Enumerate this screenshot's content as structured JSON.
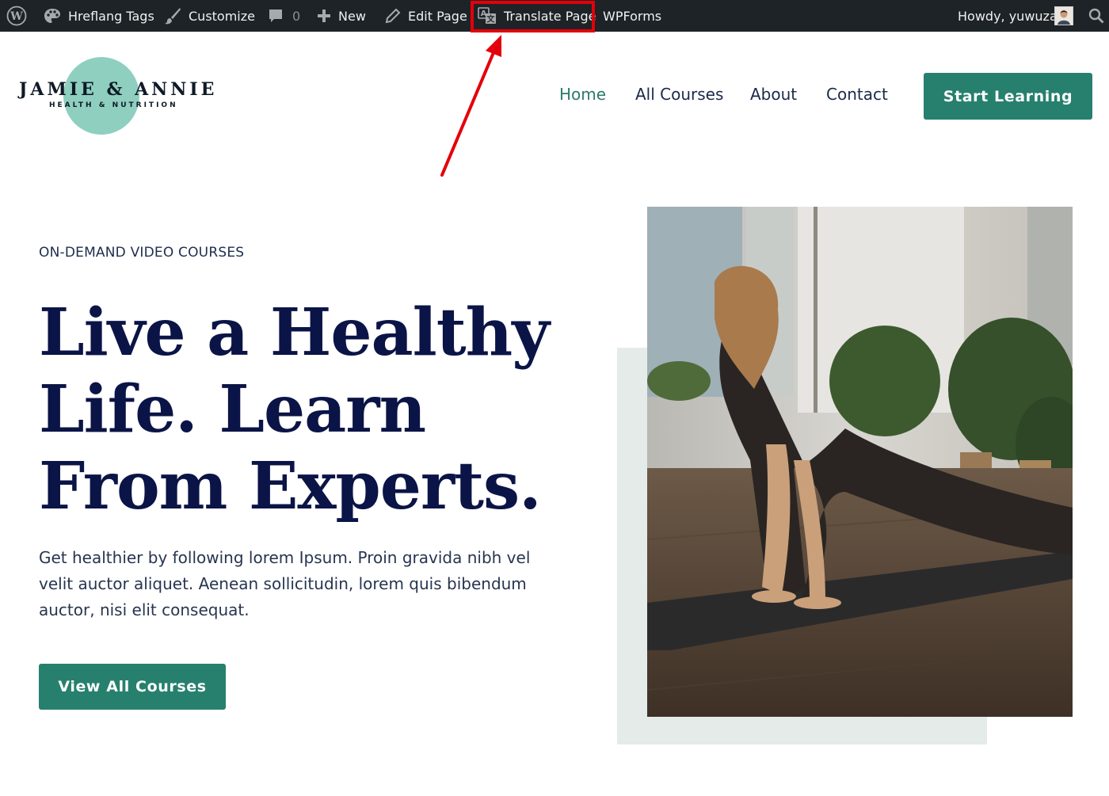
{
  "admin_bar": {
    "items": [
      {
        "icon": "wordpress-logo-icon",
        "label": ""
      },
      {
        "icon": "palette-icon",
        "label": "Hreflang Tags"
      },
      {
        "icon": "paintbrush-icon",
        "label": "Customize"
      },
      {
        "icon": "comment-icon",
        "label": "0"
      },
      {
        "icon": "plus-icon",
        "label": "New"
      },
      {
        "icon": "pencil-icon",
        "label": "Edit Page"
      },
      {
        "icon": "translate-icon",
        "label": "Translate Page"
      },
      {
        "icon": "",
        "label": "WPForms"
      }
    ],
    "greeting": "Howdy, yuwuza",
    "search_icon": "search-icon",
    "highlight_color": "#e3000a"
  },
  "logo": {
    "name": "JAMIE & ANNIE",
    "tagline": "HEALTH & NUTRITION",
    "circle_color": "#8fcfbf"
  },
  "nav": {
    "items": [
      "Home",
      "All Courses",
      "About",
      "Contact"
    ],
    "active": "Home",
    "cta": "Start Learning"
  },
  "hero": {
    "eyebrow": "ON-DEMAND VIDEO COURSES",
    "title": "Live a Healthy Life. Learn From Experts.",
    "body": "Get healthier by following lorem Ipsum. Proin gravida nibh vel velit auctor aliquet. Aenean sollicitudin, lorem quis bibendum auctor, nisi elit consequat.",
    "cta": "View All Courses"
  },
  "colors": {
    "accent": "#27806e",
    "heading": "#0b1446",
    "admin_bar_bg": "#1d2327"
  }
}
